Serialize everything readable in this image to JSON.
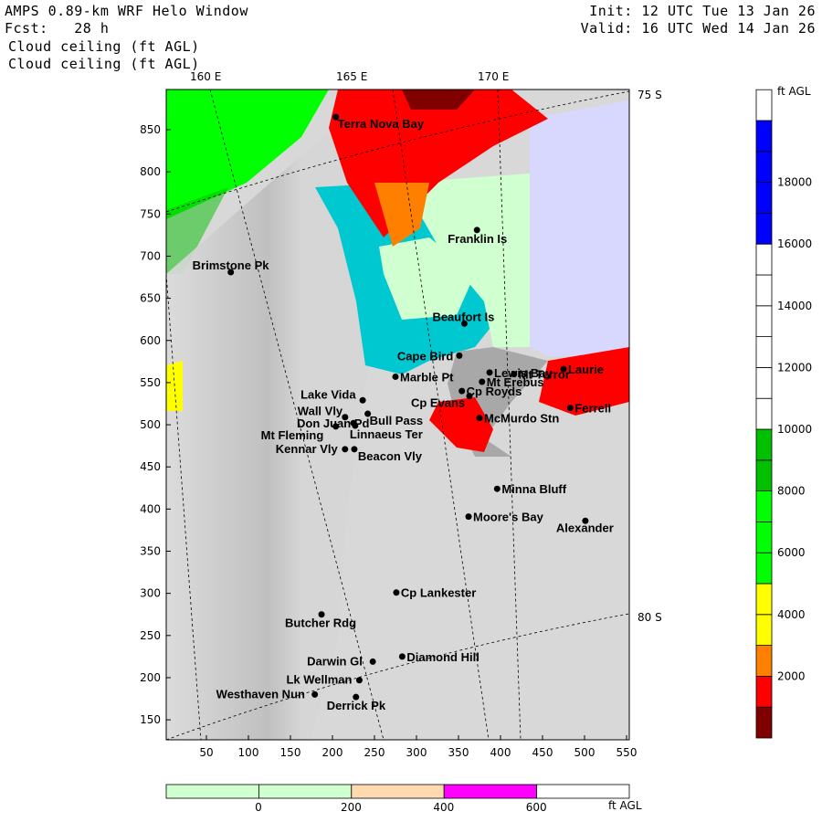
{
  "header": {
    "title": "AMPS 0.89-km WRF Helo Window",
    "forecast": "Fcst:   28 h",
    "init": "Init: 12 UTC Tue 13 Jan 26",
    "valid": "Valid: 16 UTC Wed 14 Jan 26",
    "field_line1": "Cloud ceiling (ft AGL)",
    "field_line2": "Cloud ceiling (ft AGL)"
  },
  "map": {
    "lon_labels": [
      "160 E",
      "165 E",
      "170 E"
    ],
    "lat_labels": [
      "75 S",
      "80 S"
    ],
    "x_ticks": [
      50,
      100,
      150,
      200,
      250,
      300,
      350,
      400,
      450,
      500,
      550
    ],
    "y_ticks": [
      150,
      200,
      250,
      300,
      350,
      400,
      450,
      500,
      550,
      600,
      650,
      700,
      750,
      800,
      850
    ],
    "stations": [
      {
        "name": "Terra Nova Bay",
        "x": 204,
        "y": 865
      },
      {
        "name": "Franklin Is",
        "x": 372,
        "y": 731
      },
      {
        "name": "Brimstone Pk",
        "x": 79,
        "y": 681
      },
      {
        "name": "Beaufort Is",
        "x": 357,
        "y": 620
      },
      {
        "name": "Cape Bird",
        "x": 351,
        "y": 582
      },
      {
        "name": "Marble Pt",
        "x": 275,
        "y": 557
      },
      {
        "name": "Lewis Bay",
        "x": 387,
        "y": 562
      },
      {
        "name": "Mt Terror",
        "x": 416,
        "y": 560
      },
      {
        "name": "Laurie",
        "x": 475,
        "y": 566
      },
      {
        "name": "Cp Royds",
        "x": 354,
        "y": 540
      },
      {
        "name": "Mt Erebus",
        "x": 378,
        "y": 551
      },
      {
        "name": "Cp Evans",
        "x": 363,
        "y": 534
      },
      {
        "name": "Ferrell",
        "x": 483,
        "y": 520
      },
      {
        "name": "McMurdo Stn",
        "x": 375,
        "y": 508
      },
      {
        "name": "Lake Vida",
        "x": 236,
        "y": 529
      },
      {
        "name": "Wall Vly",
        "x": 215,
        "y": 509
      },
      {
        "name": "Bull Pass",
        "x": 242,
        "y": 513
      },
      {
        "name": "Don Juan Pd",
        "x": 225,
        "y": 502
      },
      {
        "name": "Mt Fleming",
        "x": 204,
        "y": 498
      },
      {
        "name": "Linnaeus Ter",
        "x": 227,
        "y": 499
      },
      {
        "name": "Kennar Vly",
        "x": 215,
        "y": 471
      },
      {
        "name": "Beacon Vly",
        "x": 226,
        "y": 471
      },
      {
        "name": "Minna Bluff",
        "x": 396,
        "y": 424
      },
      {
        "name": "Moore's Bay",
        "x": 362,
        "y": 391
      },
      {
        "name": "Alexander",
        "x": 501,
        "y": 386
      },
      {
        "name": "Cp Lankester",
        "x": 276,
        "y": 301
      },
      {
        "name": "Butcher Rdg",
        "x": 187,
        "y": 275
      },
      {
        "name": "Diamond Hill",
        "x": 283,
        "y": 225
      },
      {
        "name": "Darwin Gl",
        "x": 248,
        "y": 219
      },
      {
        "name": "Lk Wellman",
        "x": 232,
        "y": 197
      },
      {
        "name": "Westhaven Nun",
        "x": 179,
        "y": 180
      },
      {
        "name": "Derrick Pk",
        "x": 228,
        "y": 177
      }
    ]
  },
  "colorbar": {
    "unit": "ft AGL",
    "labels": [
      "2000",
      "4000",
      "6000",
      "8000",
      "10000",
      "12000",
      "14000",
      "16000",
      "18000"
    ],
    "bins": [
      {
        "from": 0,
        "to": 1000,
        "color": "#800000"
      },
      {
        "from": 1000,
        "to": 2000,
        "color": "#ff0000"
      },
      {
        "from": 2000,
        "to": 3000,
        "color": "#ff8000"
      },
      {
        "from": 3000,
        "to": 4000,
        "color": "#ffff00"
      },
      {
        "from": 4000,
        "to": 5000,
        "color": "#ffff00"
      },
      {
        "from": 5000,
        "to": 6000,
        "color": "#00ff00"
      },
      {
        "from": 6000,
        "to": 7000,
        "color": "#00ff00"
      },
      {
        "from": 7000,
        "to": 8000,
        "color": "#00ff00"
      },
      {
        "from": 8000,
        "to": 9000,
        "color": "#00c000"
      },
      {
        "from": 9000,
        "to": 10000,
        "color": "#00c000"
      },
      {
        "from": 10000,
        "to": 11000,
        "color": "#ffffff"
      },
      {
        "from": 11000,
        "to": 12000,
        "color": "#ffffff"
      },
      {
        "from": 12000,
        "to": 13000,
        "color": "#ffffff"
      },
      {
        "from": 13000,
        "to": 14000,
        "color": "#ffffff"
      },
      {
        "from": 14000,
        "to": 15000,
        "color": "#ffffff"
      },
      {
        "from": 15000,
        "to": 16000,
        "color": "#ffffff"
      },
      {
        "from": 16000,
        "to": 17000,
        "color": "#0000ff"
      },
      {
        "from": 17000,
        "to": 18000,
        "color": "#0000ff"
      },
      {
        "from": 18000,
        "to": 19000,
        "color": "#0000ff"
      },
      {
        "from": 19000,
        "to": 20000,
        "color": "#0000ff"
      },
      {
        "from": 20000,
        "to": 21000,
        "color": "#ffffff"
      }
    ]
  },
  "bottom_bar": {
    "unit": "ft AGL",
    "labels": [
      "0",
      "200",
      "400",
      "600"
    ],
    "bins": [
      "#d0ffd0",
      "#d0ffd0",
      "#ffdab0",
      "#ff00ff",
      "#ffffff"
    ]
  }
}
